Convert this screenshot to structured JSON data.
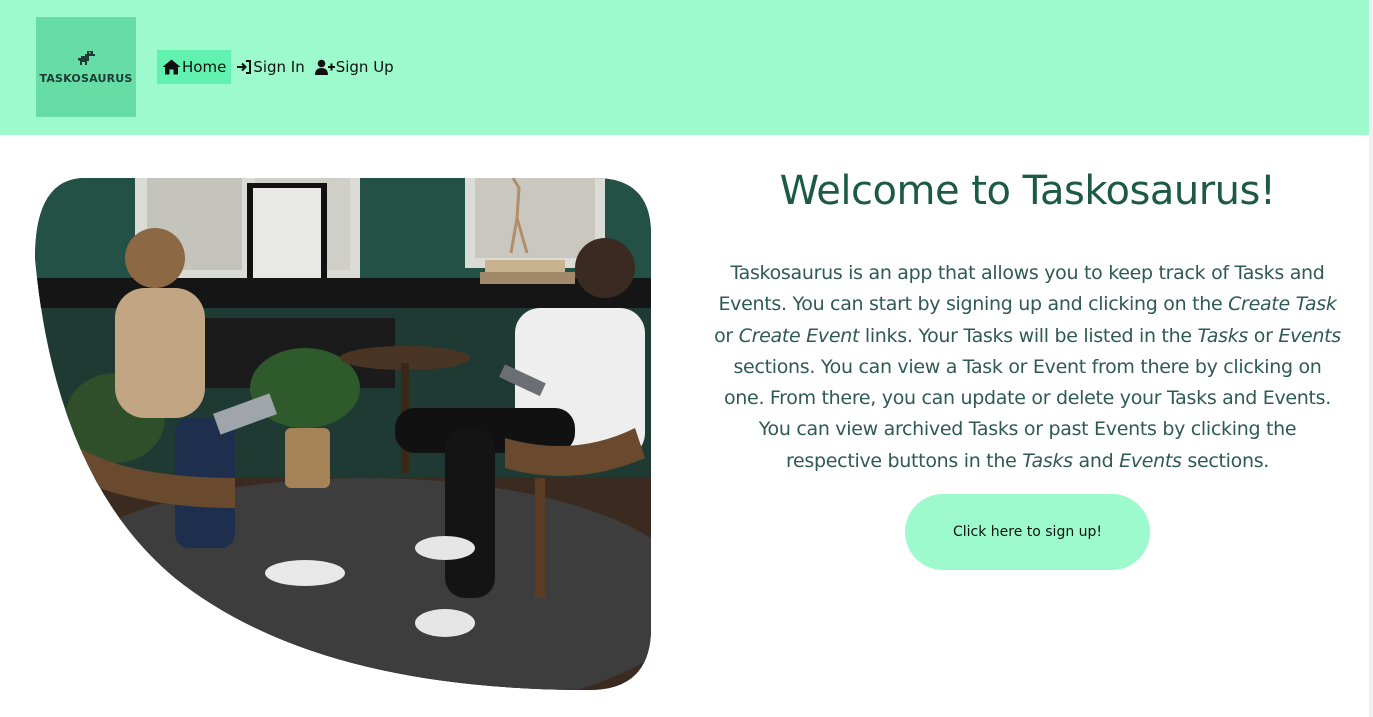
{
  "header": {
    "logo_text": "TASKOSAURUS",
    "nav": [
      {
        "label": "Home",
        "icon": "home-icon",
        "active": true
      },
      {
        "label": "Sign In",
        "icon": "sign-in-icon",
        "active": false
      },
      {
        "label": "Sign Up",
        "icon": "user-plus-icon",
        "active": false
      }
    ]
  },
  "hero": {
    "image_alt": "Two people sitting in chairs talking"
  },
  "main": {
    "title": "Welcome to Taskosaurus!",
    "intro": {
      "p1": "Taskosaurus is an app that allows you to keep track of Tasks and Events. You can start by signing up and clicking on the ",
      "create_task": "Create Task",
      "p2": " or ",
      "create_event": "Create Event",
      "p3": " links. Your Tasks will be listed in the ",
      "tasks1": "Tasks",
      "p4": " or ",
      "events1": "Events",
      "p5": " sections. You can view a Task or Event from there by clicking on one. From there, you can update or delete your Tasks and Events. You can view archived Tasks or past Events by clicking the respective buttons in the ",
      "tasks2": "Tasks",
      "p6": " and ",
      "events2": "Events",
      "p7": " sections."
    },
    "cta_label": "Click here to sign up!"
  },
  "colors": {
    "header_bg": "#9cfacd",
    "logo_bg": "#66dda5",
    "nav_active_bg": "#62f2b0",
    "title": "#1c5a46",
    "body_text": "#2e5a52",
    "cta_bg": "#9cfacd"
  }
}
